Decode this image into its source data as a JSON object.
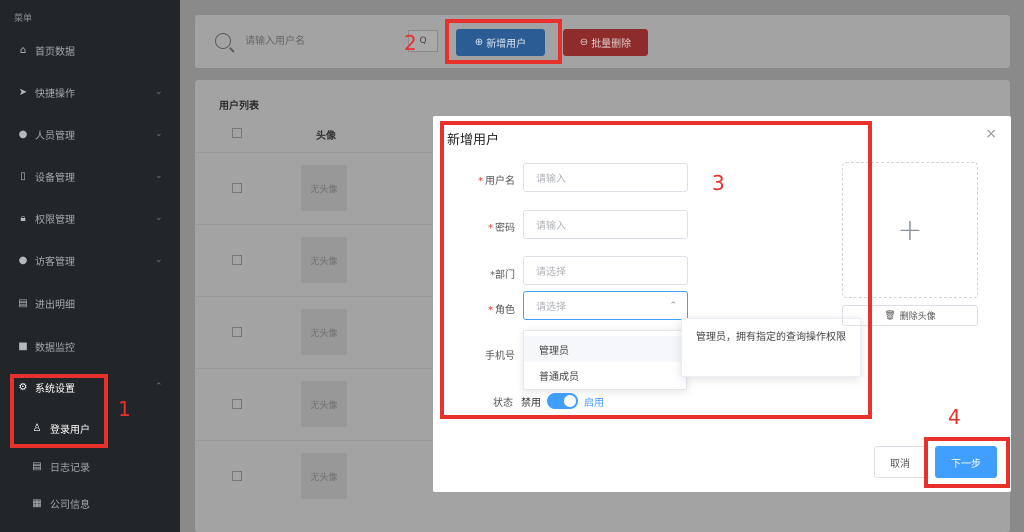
{
  "sidebar": {
    "title": "菜单",
    "items": [
      {
        "label": "首页数据",
        "icon": "home-icon"
      },
      {
        "label": "快捷操作",
        "icon": "send-icon"
      },
      {
        "label": "人员管理",
        "icon": "user-icon"
      },
      {
        "label": "设备管理",
        "icon": "tablet-icon"
      },
      {
        "label": "权限管理",
        "icon": "lock-icon"
      },
      {
        "label": "访客管理",
        "icon": "visitor-icon"
      },
      {
        "label": "进出明细",
        "icon": "document-icon"
      },
      {
        "label": "数据监控",
        "icon": "camera-icon"
      },
      {
        "label": "系统设置",
        "icon": "gear-icon"
      },
      {
        "label": "登录用户",
        "icon": "user-outline-icon"
      },
      {
        "label": "日志记录",
        "icon": "log-icon"
      },
      {
        "label": "公司信息",
        "icon": "company-icon"
      }
    ]
  },
  "toolbar": {
    "search_placeholder": "请输入用户名",
    "search_btn": "Q",
    "add_label": "新增用户",
    "batch_delete_label": "批量删除"
  },
  "list": {
    "title": "用户列表",
    "col_avatar": "头像",
    "no_avatar": "无头像"
  },
  "annotations": [
    "1",
    "2",
    "3",
    "4"
  ],
  "modal": {
    "title": "新增用户",
    "close": "×",
    "fields": {
      "username": {
        "label": "用户名",
        "placeholder": "请输入"
      },
      "password": {
        "label": "密码",
        "placeholder": "请输入"
      },
      "dept": {
        "label": "*部门",
        "placeholder": "请选择"
      },
      "role": {
        "label": "角色",
        "placeholder": "请选择"
      },
      "phone": {
        "label": "手机号"
      },
      "status": {
        "label": "状态",
        "off": "禁用",
        "on": "启用",
        "enabled": true
      }
    },
    "role_options": [
      "管理员",
      "普通成员"
    ],
    "role_tooltip": "管理员，拥有指定的查询操作权限",
    "delete_avatar": "删除头像",
    "cancel": "取消",
    "next": "下一步"
  },
  "colors": {
    "accent": "#409eff",
    "annotation": "#e8312c",
    "sidebar": "#222629"
  }
}
